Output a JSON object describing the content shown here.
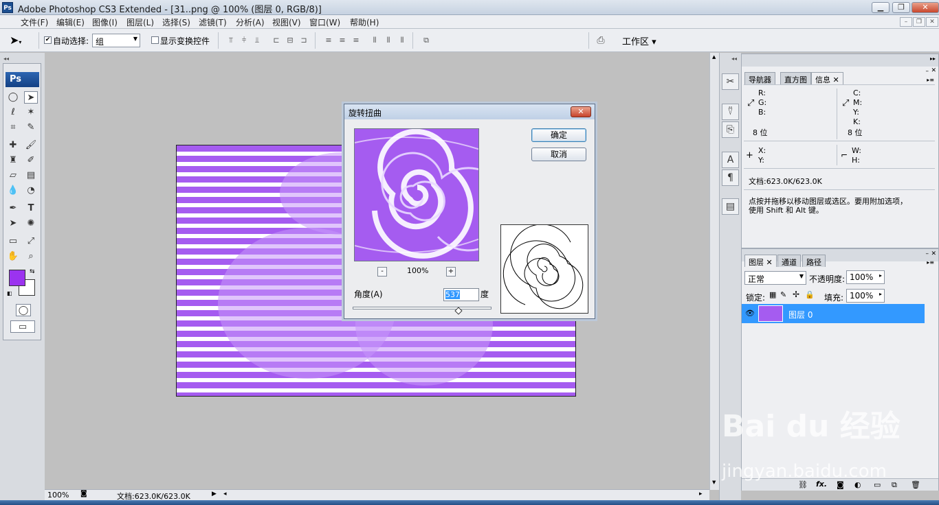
{
  "window": {
    "title": "Adobe Photoshop CS3 Extended - [31..png @ 100% (图层 0, RGB/8)]",
    "logo": "Ps"
  },
  "menu": [
    "文件(F)",
    "编辑(E)",
    "图像(I)",
    "图层(L)",
    "选择(S)",
    "滤镜(T)",
    "分析(A)",
    "视图(V)",
    "窗口(W)",
    "帮助(H)"
  ],
  "options": {
    "auto_select_label": "自动选择:",
    "auto_select_value": "组",
    "show_transform_label": "显示变换控件",
    "workspace_label": "工作区"
  },
  "toolbox": {
    "header": "Ps",
    "fg_color": "#9b33ef",
    "bg_color": "#ffffff"
  },
  "status": {
    "zoom": "100%",
    "doc_size": "文档:623.0K/623.0K"
  },
  "info_panel": {
    "tabs": [
      "导航器",
      "直方图",
      "信息"
    ],
    "r": "R:",
    "g": "G:",
    "b": "B:",
    "c": "C:",
    "m": "M:",
    "y": "Y:",
    "k": "K:",
    "bit_left": "8 位",
    "bit_right": "8 位",
    "x": "X:",
    "y2": "Y:",
    "w": "W:",
    "h": "H:",
    "doc_size": "文档:623.0K/623.0K",
    "hint_line1": "点按并拖移以移动图层或选区。要用附加选项，",
    "hint_line2": "使用 Shift 和 Alt 键。"
  },
  "layers_panel": {
    "tabs": [
      "图层",
      "通道",
      "路径"
    ],
    "blend_mode": "正常",
    "opacity_label": "不透明度:",
    "opacity_value": "100%",
    "lock_label": "锁定:",
    "fill_label": "填充:",
    "fill_value": "100%",
    "layer_name": "图层 0"
  },
  "dialog": {
    "title": "旋转扭曲",
    "ok_label": "确定",
    "cancel_label": "取消",
    "zoom_value": "100%",
    "zoom_minus": "-",
    "zoom_plus": "+",
    "angle_label": "角度(A)",
    "angle_value": "537",
    "angle_unit": "度"
  },
  "watermark": {
    "brand": "Bai du 经验",
    "url": "jingyan.baidu.com"
  }
}
